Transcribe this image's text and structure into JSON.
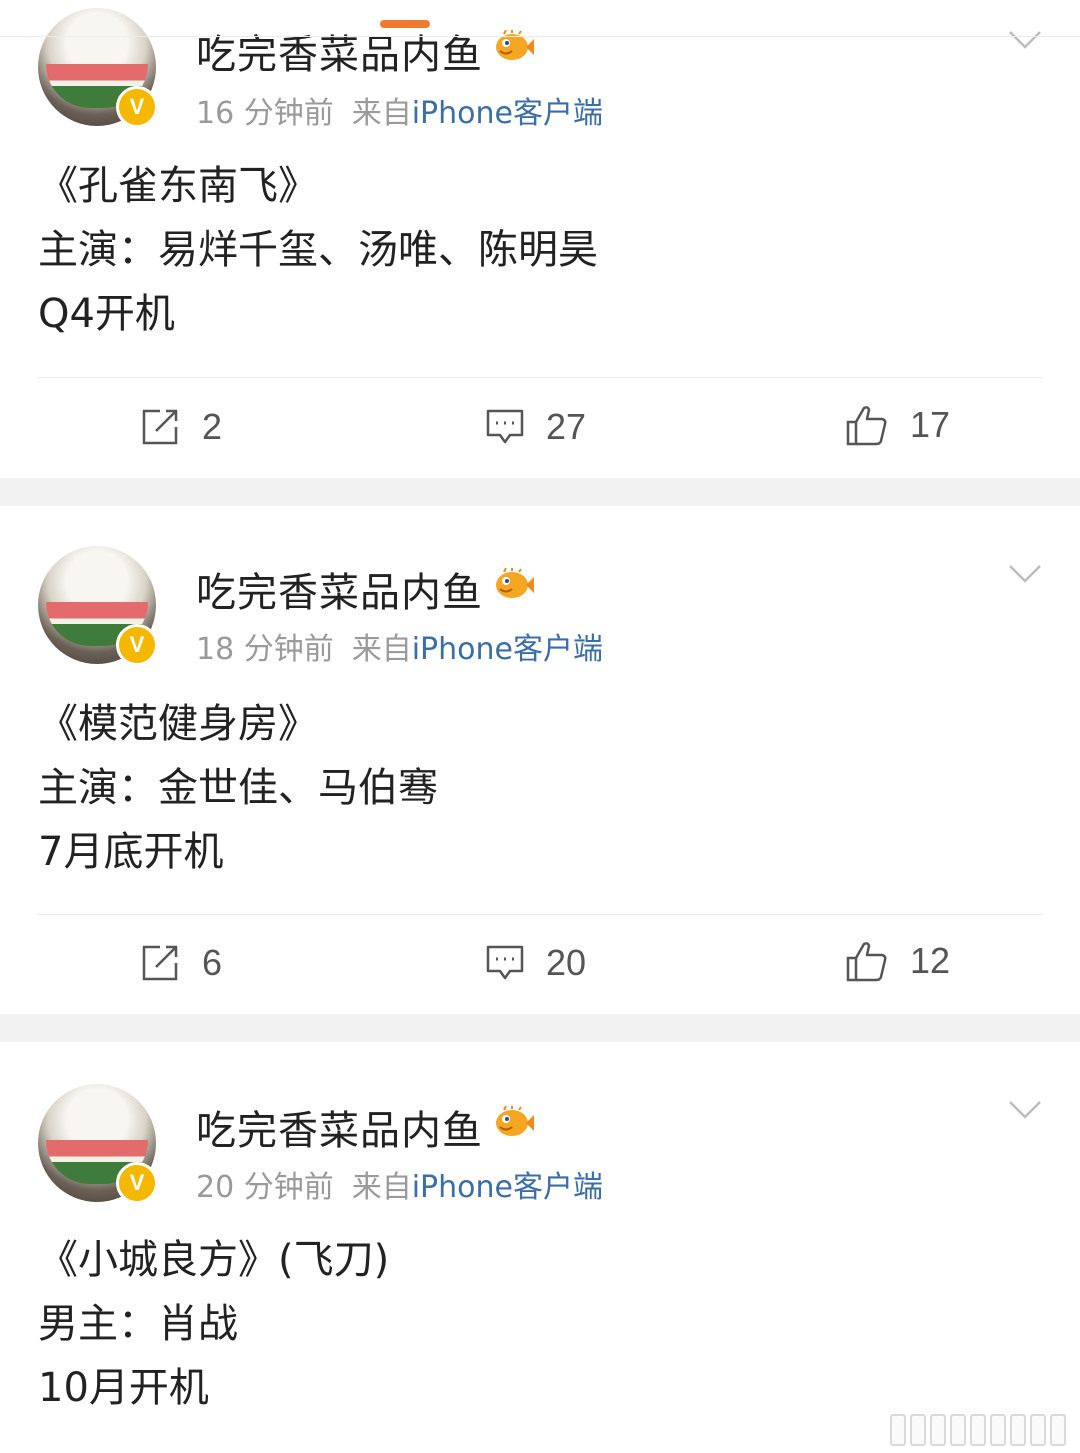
{
  "posts": [
    {
      "username": "吃完香菜品内鱼",
      "time": "16 分钟前",
      "source_prefix": "来自",
      "source_app": "iPhone客户端",
      "lines": [
        "《孔雀东南飞》",
        "主演：易烊千玺、汤唯、陈明昊",
        "Q4开机"
      ],
      "reposts": "2",
      "comments": "27",
      "likes": "17"
    },
    {
      "username": "吃完香菜品内鱼",
      "time": "18 分钟前",
      "source_prefix": "来自",
      "source_app": "iPhone客户端",
      "lines": [
        "《模范健身房》",
        "主演：金世佳、马伯骞",
        "7月底开机"
      ],
      "reposts": "6",
      "comments": "20",
      "likes": "12"
    },
    {
      "username": "吃完香菜品内鱼",
      "time": "20 分钟前",
      "source_prefix": "来自",
      "source_app": "iPhone客户端",
      "lines": [
        "《小城良方》(飞刀)",
        "男主：肖战",
        "10月开机"
      ]
    }
  ],
  "icons": {
    "verified": "verified-v-badge-icon",
    "member": "pufferfish-icon",
    "menu": "chevron-down-icon",
    "repost": "repost-icon",
    "comment": "comment-icon",
    "like": "thumbs-up-icon"
  },
  "verified_letter": "V",
  "colors": {
    "accent": "#f07a2e",
    "link": "#3b6ea8",
    "verified": "#f5b800",
    "meta": "#9a9a9a"
  }
}
